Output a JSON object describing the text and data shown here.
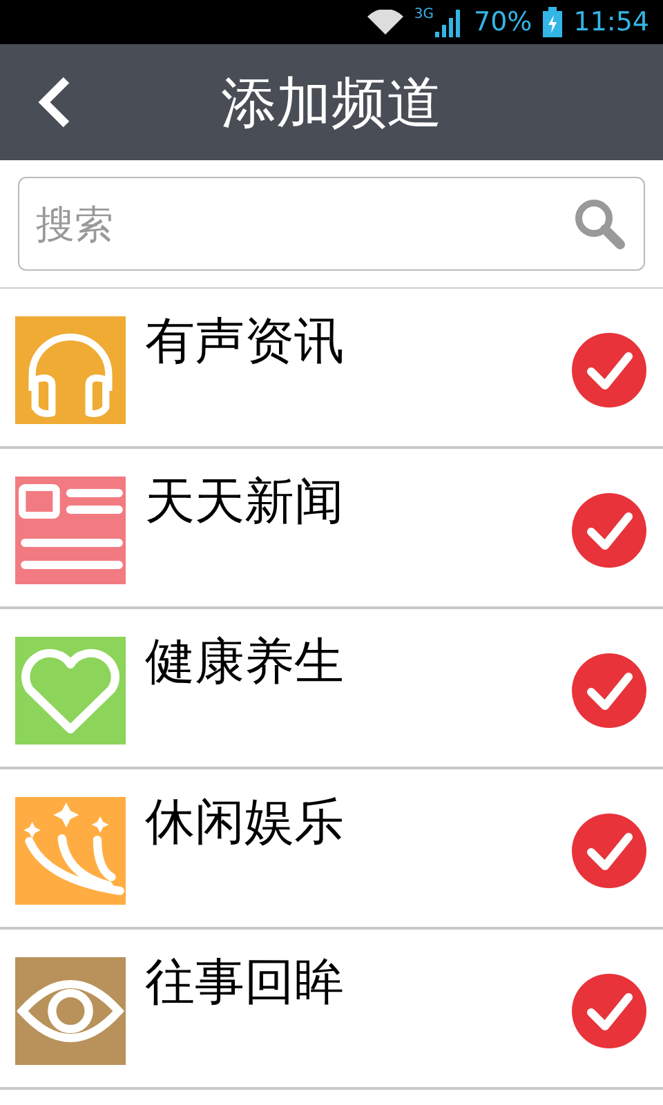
{
  "status_bar": {
    "network": "3G",
    "battery": "70%",
    "time": "11:54"
  },
  "header": {
    "title": "添加频道"
  },
  "search": {
    "placeholder": "搜索"
  },
  "channels": [
    {
      "name": "有声资讯",
      "kind": "headphones",
      "color": "#efab33",
      "checked": true
    },
    {
      "name": "天天新闻",
      "kind": "news",
      "color": "#f27b81",
      "checked": true
    },
    {
      "name": "健康养生",
      "kind": "heart",
      "color": "#8cd45a",
      "checked": true
    },
    {
      "name": "休闲娱乐",
      "kind": "stars",
      "color": "#ffad42",
      "checked": true
    },
    {
      "name": "往事回眸",
      "kind": "eye",
      "color": "#b8925a",
      "checked": true
    }
  ]
}
